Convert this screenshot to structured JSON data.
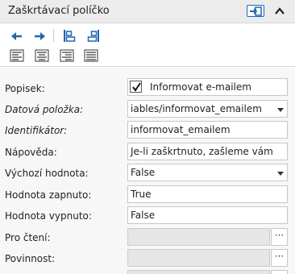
{
  "panel": {
    "title": "Zaškrtávací políčko",
    "export_icon": "panel-export-icon",
    "collapse_icon": "chevron-up-icon"
  },
  "toolbar": {
    "buttons": [
      {
        "name": "arrow-left-icon"
      },
      {
        "name": "arrow-right-icon"
      },
      {
        "name": "align-top-left-icon"
      },
      {
        "name": "align-top-right-icon"
      },
      {
        "name": "text-align-left-icon"
      },
      {
        "name": "text-align-center-icon"
      },
      {
        "name": "text-align-right-icon"
      },
      {
        "name": "text-justify-icon"
      }
    ]
  },
  "form": {
    "popisek": {
      "label": "Popisek:",
      "value": "Informovat e-mailem",
      "checked": true
    },
    "datova_polozka": {
      "label": "Datová položka:",
      "value": "iables/informovat_emailem"
    },
    "identifikator": {
      "label": "Identifikátor:",
      "value": "informovat_emailem"
    },
    "napoveda": {
      "label": "Nápověda:",
      "value": "Je-li zaškrtnuto, zašleme vám"
    },
    "vychozi_hodnota": {
      "label": "Výchozí hodnota:",
      "value": "False"
    },
    "hodnota_zapnuto": {
      "label": "Hodnota zapnuto:",
      "value": "True"
    },
    "hodnota_vypnuto": {
      "label": "Hodnota vypnuto:",
      "value": "False"
    },
    "pro_cteni": {
      "label": "Pro čtení:",
      "button": "···"
    },
    "povinnost": {
      "label": "Povinnost:",
      "button": "···"
    }
  },
  "colors": {
    "accent_blue": "#1e66b5",
    "header_bg": "#ececec",
    "form_bg": "#f7f7f7",
    "disabled_bg": "#e6e6e6"
  }
}
